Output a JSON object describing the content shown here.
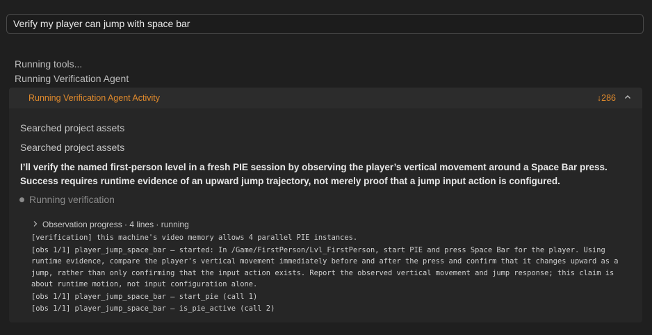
{
  "prompt": {
    "text": "Verify my player can jump with space bar"
  },
  "status": {
    "line1": "Running tools...",
    "line2": "Running Verification Agent"
  },
  "activity": {
    "title": "Running Verification Agent Activity",
    "count": "↓286",
    "collapse_icon": "chevron-up-icon",
    "steps": [
      "Searched project assets",
      "Searched project assets"
    ],
    "plan": "I’ll verify the named first-person level in a fresh PIE session by observing the player’s vertical movement around a Space Bar press. Success requires runtime evidence of an upward jump trajectory, not merely proof that a jump input action is configured.",
    "running_label": "Running verification",
    "progress_label": "Observation progress · 4 lines · running",
    "log": [
      "[verification] this machine's video memory allows 4 parallel PIE instances.",
      "[obs 1/1] player_jump_space_bar — started: In /Game/FirstPerson/Lvl_FirstPerson, start PIE and press Space Bar for the player. Using runtime evidence, compare the player's vertical movement immediately before and after the press and confirm that it changes upward as a jump, rather than only confirming that the input action exists. Report the observed vertical movement and jump response; this claim is about runtime motion, not input configuration alone.",
      "[obs 1/1] player_jump_space_bar — start_pie (call 1)",
      "[obs 1/1] player_jump_space_bar — is_pie_active (call 2)"
    ]
  },
  "colors": {
    "background": "#1f1f1f",
    "panel": "#262626",
    "accent": "#e08a2c"
  }
}
